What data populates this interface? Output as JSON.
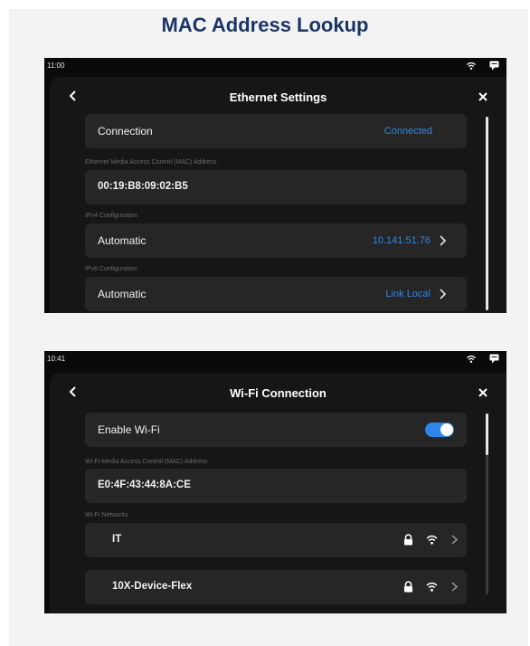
{
  "document": {
    "title": "MAC Address Lookup"
  },
  "ethernet_screen": {
    "status_time": "11:00",
    "title": "Ethernet Settings",
    "connection": {
      "label": "Connection",
      "value": "Connected"
    },
    "mac_section_label": "Ethernet Media Access Control (MAC) Address",
    "mac_address": "00:19:B8:09:02:B5",
    "ipv4": {
      "section_label": "IPv4 Configuration",
      "label": "Automatic",
      "value": "10.141.51.76"
    },
    "ipv6": {
      "section_label": "IPv6 Configuration",
      "label": "Automatic",
      "value": "Link Local"
    }
  },
  "wifi_screen": {
    "status_time": "10:41",
    "title": "Wi-Fi Connection",
    "enable": {
      "label": "Enable Wi-Fi",
      "enabled": true
    },
    "mac_section_label": "Wi-Fi Media Access Control (MAC) Address",
    "mac_address": "E0:4F:43:44:8A:CE",
    "networks_label": "Wi-Fi Networks",
    "networks": [
      {
        "name": "IT",
        "icons": [
          "lock-icon",
          "wifi-icon",
          "chevron-right-icon"
        ]
      },
      {
        "name": "10X-Device-Flex",
        "icons": [
          "lock-icon",
          "wifi-icon",
          "chevron-right-icon"
        ]
      }
    ]
  },
  "colors": {
    "accent": "#2f86e8",
    "title": "#1a3566",
    "panel": "#161616",
    "card": "#262626"
  }
}
